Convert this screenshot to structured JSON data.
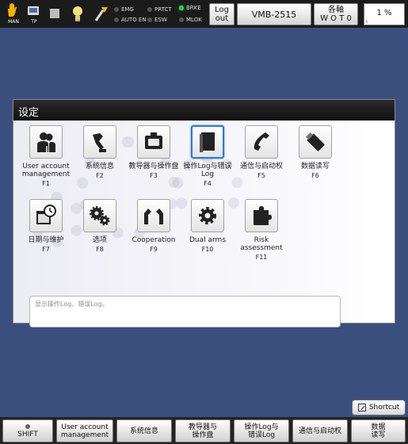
{
  "topbar": {
    "mode_label": "MAN",
    "tp_label": "TP",
    "indicators": {
      "emg": "EMG",
      "prtct": "PRTCT",
      "brke": "BRKE",
      "auto_en": "AUTO EN",
      "esw": "ESW",
      "mlok": "MLOK"
    },
    "logout_label": "Log out",
    "robot_label": "VMB-2515",
    "axis_label_line1": "各軸",
    "axis_label_line2": "W O T 0",
    "speed_percent": "1 %",
    "speed_fraction": 0.01,
    "colors": {
      "led_on": "#2ed14a",
      "led_off": "#555555"
    }
  },
  "panel": {
    "title": "设定",
    "tiles": [
      {
        "icon": "users-icon",
        "name": "User account management",
        "key": "F1"
      },
      {
        "icon": "robot-arm-icon",
        "name": "系统信息",
        "key": "F2"
      },
      {
        "icon": "teach-pendant-icon",
        "name": "教导器与操作盘",
        "key": "F3"
      },
      {
        "icon": "book-icon",
        "name": "操作Log与错误Log",
        "key": "F4",
        "selected": true
      },
      {
        "icon": "phone-icon",
        "name": "通信与启动权",
        "key": "F5"
      },
      {
        "icon": "usb-drive-icon",
        "name": "数据读写",
        "key": "F6"
      },
      {
        "icon": "calendar-clock-icon",
        "name": "日期与维护",
        "key": "F7"
      },
      {
        "icon": "gears-icon",
        "name": "选项",
        "key": "F8"
      },
      {
        "icon": "two-robots-icon",
        "name": "Cooperation",
        "key": "F9"
      },
      {
        "icon": "gear-icon",
        "name": "Dual arms",
        "key": "F10"
      },
      {
        "icon": "puzzle-icon",
        "name": "Risk assessment",
        "key": "F11"
      }
    ],
    "description": "显示操作Log、错误Log。",
    "colors": {
      "selected_border": "#2f78d6"
    }
  },
  "shortcut_label": "Shortcut",
  "fkeys": {
    "shift": "SHIFT",
    "f1": "User account management",
    "f2": "系统信息",
    "f3": "教导器与操作盘",
    "f4": "操作Log与错误Log",
    "f5": "通信与启动权",
    "f6": "数据读写"
  }
}
